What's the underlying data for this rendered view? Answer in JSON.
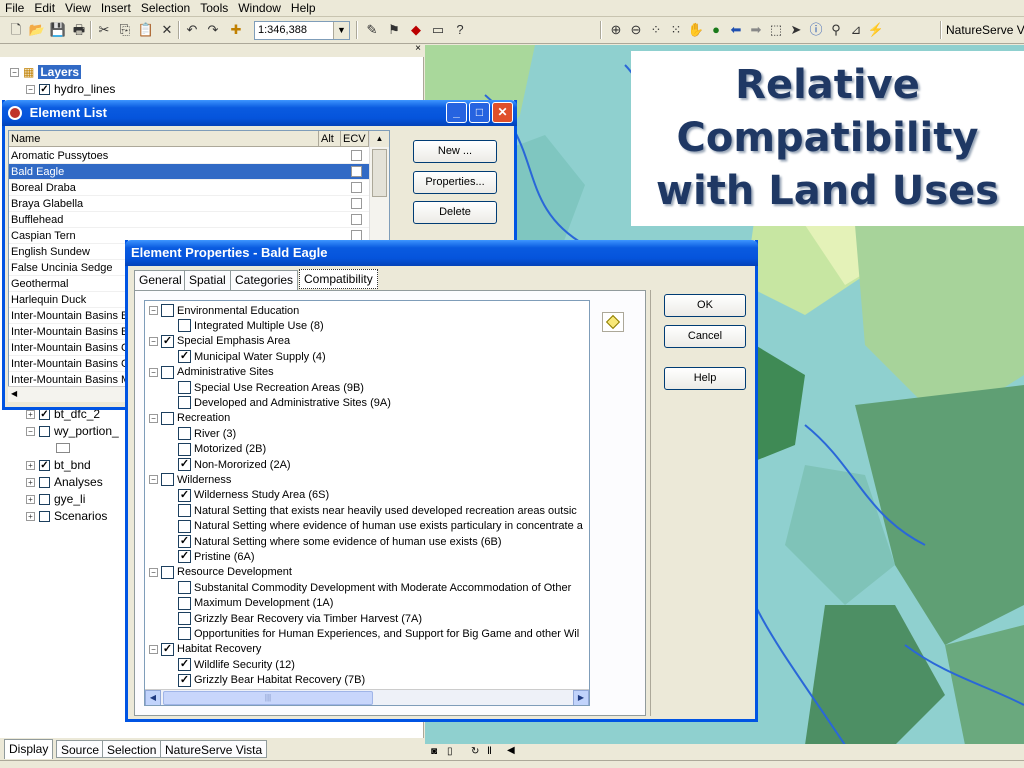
{
  "menu": [
    "File",
    "Edit",
    "View",
    "Insert",
    "Selection",
    "Tools",
    "Window",
    "Help"
  ],
  "toolbar": {
    "scale": "1:346,388",
    "extension_label": "NatureServe V"
  },
  "slide": {
    "title_line1": "Relative",
    "title_line2": "Compatibility",
    "title_line3": "with Land Uses"
  },
  "toc": {
    "root": "Layers",
    "items": [
      "hydro_lines",
      "bt_dfc_2",
      "wy_portion_",
      "bt_bnd",
      "Analyses",
      "gye_li",
      "Scenarios"
    ],
    "tabs": [
      "Display",
      "Source",
      "Selection",
      "NatureServe Vista"
    ]
  },
  "element_list": {
    "title": "Element List",
    "columns": [
      "Name",
      "Alt",
      "ECV"
    ],
    "rows": [
      "Aromatic Pussytoes",
      "Bald Eagle",
      "Boreal Draba",
      "Braya Glabella",
      "Bufflehead",
      "Caspian Tern",
      "English Sundew",
      "False Uncinia Sedge",
      "Geothermal",
      "Harlequin Duck",
      "Inter-Mountain Basins B",
      "Inter-Mountain Basins B",
      "Inter-Mountain Basins C",
      "Inter-Mountain Basins G",
      "Inter-Mountain Basins M"
    ],
    "selected": "Bald Eagle",
    "buttons": {
      "new": "New ...",
      "properties": "Properties...",
      "delete": "Delete"
    }
  },
  "element_properties": {
    "title": "Element Properties - Bald Eagle",
    "tabs": [
      "General",
      "Spatial",
      "Categories",
      "Compatibility"
    ],
    "buttons": {
      "ok": "OK",
      "cancel": "Cancel",
      "help": "Help"
    },
    "tree": [
      {
        "label": "Environmental Education",
        "checked": false,
        "children": [
          {
            "label": "Integrated Multiple Use (8)",
            "checked": false
          }
        ]
      },
      {
        "label": "Special Emphasis Area",
        "checked": true,
        "children": [
          {
            "label": "Municipal Water Supply (4)",
            "checked": true
          }
        ]
      },
      {
        "label": "Administrative Sites",
        "checked": false,
        "children": [
          {
            "label": "Special Use Recreation Areas (9B)",
            "checked": false
          },
          {
            "label": "Developed and Administrative Sites (9A)",
            "checked": false
          }
        ]
      },
      {
        "label": "Recreation",
        "checked": false,
        "children": [
          {
            "label": "River (3)",
            "checked": false
          },
          {
            "label": "Motorized (2B)",
            "checked": false
          },
          {
            "label": "Non-Mororized (2A)",
            "checked": true
          }
        ]
      },
      {
        "label": "Wilderness",
        "checked": false,
        "children": [
          {
            "label": "Wilderness Study Area (6S)",
            "checked": true
          },
          {
            "label": "Natural Setting that exists near heavily used developed recreation areas outsic",
            "checked": false
          },
          {
            "label": "Natural Setting where evidence of human use exists particulary in concentrate a",
            "checked": false
          },
          {
            "label": "Natural Setting where some evidence of human use exists (6B)",
            "checked": true
          },
          {
            "label": "Pristine (6A)",
            "checked": true
          }
        ]
      },
      {
        "label": "Resource Development",
        "checked": false,
        "children": [
          {
            "label": "Substanital Commodity Development with Moderate Accommodation of Other",
            "checked": false
          },
          {
            "label": "Maximum Development (1A)",
            "checked": false
          },
          {
            "label": "Grizzly Bear Recovery via Timber Harvest (7A)",
            "checked": false
          },
          {
            "label": "Opportunities for Human Experiences, and Support for Big Game and other Wil",
            "checked": false
          }
        ]
      },
      {
        "label": "Habitat Recovery",
        "checked": true,
        "children": [
          {
            "label": "Wildlife Security (12)",
            "checked": true
          },
          {
            "label": "Grizzly Bear Habitat Recovery (7B)",
            "checked": true
          }
        ]
      }
    ]
  },
  "colors": {
    "xp_title": "#0554dc",
    "selection": "#316ac5",
    "slide_title": "#1f3864"
  }
}
